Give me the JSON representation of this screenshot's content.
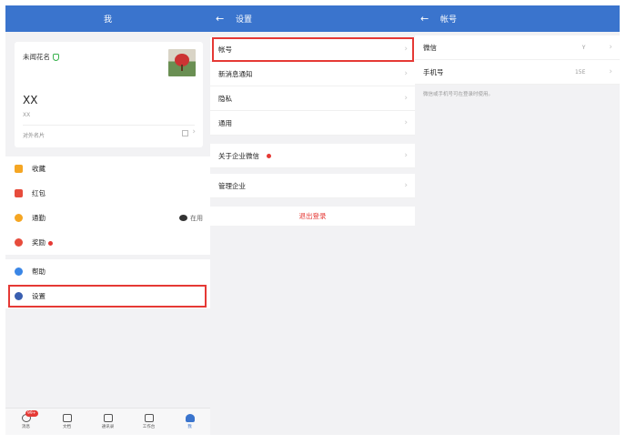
{
  "me_panel": {
    "title": "我",
    "profile": {
      "nickname": "未闻花名",
      "name": "XX",
      "subtitle": "XX",
      "external_card_label": "对外名片"
    },
    "menu": [
      {
        "label": "收藏"
      },
      {
        "label": "红包"
      },
      {
        "label": "通勤",
        "status": "在用"
      },
      {
        "label": "奖励"
      },
      {
        "label": "帮助"
      },
      {
        "label": "设置"
      }
    ],
    "tabs": [
      {
        "label": "消息",
        "badge": "99+"
      },
      {
        "label": "文档"
      },
      {
        "label": "通讯录"
      },
      {
        "label": "工作台"
      },
      {
        "label": "我"
      }
    ]
  },
  "settings_panel": {
    "title": "设置",
    "rows": [
      {
        "label": "帐号"
      },
      {
        "label": "新消息通知"
      },
      {
        "label": "隐私"
      },
      {
        "label": "通用"
      },
      {
        "label": "关于企业微信"
      },
      {
        "label": "管理企业"
      }
    ],
    "logout_label": "退出登录"
  },
  "account_panel": {
    "title": "帐号",
    "rows": [
      {
        "label": "微信",
        "value": "Y"
      },
      {
        "label": "手机号",
        "value": "15E"
      }
    ],
    "hint": "微信或手机号可在登录时使用。"
  },
  "colors": {
    "header": "#3a74cd",
    "highlight": "#e53935",
    "background": "#f2f2f4"
  }
}
